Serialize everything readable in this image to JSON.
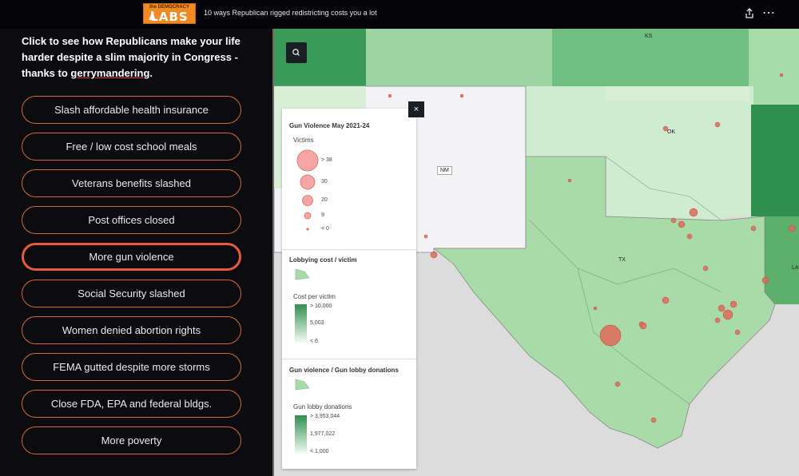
{
  "header": {
    "logo_small": "the DEMOCRACY",
    "logo_big": "LABS",
    "title": "10 ways Republican rigged redistricting costs you a lot",
    "share_icon": "share-icon",
    "more_icon": "more-options-icon",
    "more_glyph": "⋯"
  },
  "sidebar": {
    "intro_part1": "Click to see how Republicans make your life harder despite a slim majority in Congress - thanks to ",
    "intro_link": "gerrymandering",
    "intro_part2": ".",
    "buttons": [
      {
        "label": "Slash affordable health insurance",
        "active": false
      },
      {
        "label": "Free / low cost school meals",
        "active": false
      },
      {
        "label": "Veterans benefits slashed",
        "active": false
      },
      {
        "label": "Post offices closed",
        "active": false
      },
      {
        "label": "More gun violence",
        "active": true
      },
      {
        "label": "Social Security slashed",
        "active": false
      },
      {
        "label": "Women denied abortion rights",
        "active": false
      },
      {
        "label": "FEMA gutted despite more storms",
        "active": false
      },
      {
        "label": "Close FDA, EPA and federal bldgs.",
        "active": false
      },
      {
        "label": "More poverty",
        "active": false
      }
    ]
  },
  "map": {
    "search_icon": "search-icon",
    "close_label": "×",
    "state_labels": {
      "ks": "KS",
      "ok": "OK",
      "nm": "NM",
      "tx": "TX",
      "la": "LA"
    },
    "colors": {
      "water": "#dcdcdc",
      "land": "#f3f3f5",
      "point": "#e06a5a",
      "green_dark": "#2f8f4e",
      "green_mid": "#7cc48a",
      "green_light": "#d8efd6"
    }
  },
  "legend": {
    "section1_title": "Gun Violence May 2021-24",
    "section1_sub": "Victims",
    "size_classes": [
      {
        "label": "> 38"
      },
      {
        "label": "30"
      },
      {
        "label": "20"
      },
      {
        "label": "9"
      },
      {
        "label": "< 0"
      }
    ],
    "section2_title": "Lobbying cost / victim",
    "section2_sub": "Cost per victim",
    "section2_ticks": [
      "> 10,000",
      "5,003",
      "< 6"
    ],
    "section3_title": "Gun violence / Gun lobby donations",
    "section3_sub": "Gun lobby donations",
    "section3_ticks": [
      "> 3,953,044",
      "1,977,022",
      "< 1,000"
    ]
  }
}
